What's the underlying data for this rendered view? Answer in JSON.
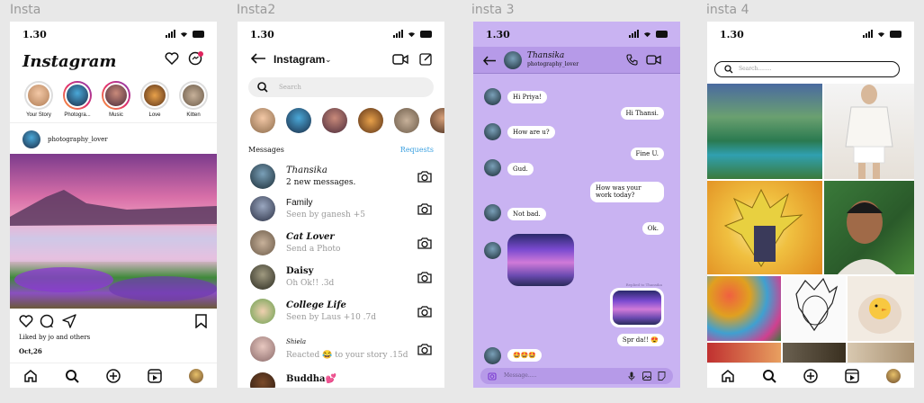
{
  "frames": [
    {
      "label": "Insta"
    },
    {
      "label": "Insta2"
    },
    {
      "label": "insta 3"
    },
    {
      "label": "insta 4"
    }
  ],
  "status": {
    "time": "1.30"
  },
  "feed": {
    "logo": "Instagram",
    "stories": [
      {
        "name": "Your Story"
      },
      {
        "name": "Photogra..."
      },
      {
        "name": "Music"
      },
      {
        "name": "Love"
      },
      {
        "name": "Kitten"
      }
    ],
    "post_user": "photography_lover",
    "liked_by": "Liked by jo and others",
    "date": "Oct,26"
  },
  "messages": {
    "header_title": "Instagram",
    "search_placeholder": "Search",
    "section_label": "Messages",
    "requests_label": "Requests",
    "chats": [
      {
        "name": "Thansika",
        "sub": "2 new messages."
      },
      {
        "name": "Family",
        "sub": "Seen by ganesh +5"
      },
      {
        "name": "Cat Lover",
        "sub": "Send a Photo"
      },
      {
        "name": "Daisy",
        "sub": "Oh Ok!! .3d"
      },
      {
        "name": "College Life",
        "sub": "Seen by Laus +10 .7d"
      },
      {
        "name": "Shiela",
        "sub": "Reacted 😂 to your story .15d"
      },
      {
        "name": "Buddha💕",
        "sub": ""
      }
    ]
  },
  "chat": {
    "contact_name": "Thansika",
    "contact_sub": "photography_lover",
    "messages": [
      {
        "side": "left",
        "text": "Hi Priya!"
      },
      {
        "side": "right",
        "text": "Hi Thansi."
      },
      {
        "side": "left",
        "text": "How are u?"
      },
      {
        "side": "right",
        "text": "Fine U."
      },
      {
        "side": "left",
        "text": "Gud."
      },
      {
        "side": "right",
        "text": "How was your work today?"
      },
      {
        "side": "left",
        "text": "Not bad."
      },
      {
        "side": "right",
        "text": "Ok."
      },
      {
        "side": "right",
        "text": "Spr da!! 😍"
      },
      {
        "side": "left",
        "text": "🤩🤩🤩"
      }
    ],
    "reply_note": "Replied to Thansika",
    "composer_placeholder": "Message....."
  },
  "explore": {
    "search_placeholder": "Search........"
  },
  "colors": {
    "chat_bg": "#c9b3f2",
    "chat_header": "#b69ae8",
    "accent_link": "#3aa0e0",
    "story_ring": "#e1306c"
  }
}
